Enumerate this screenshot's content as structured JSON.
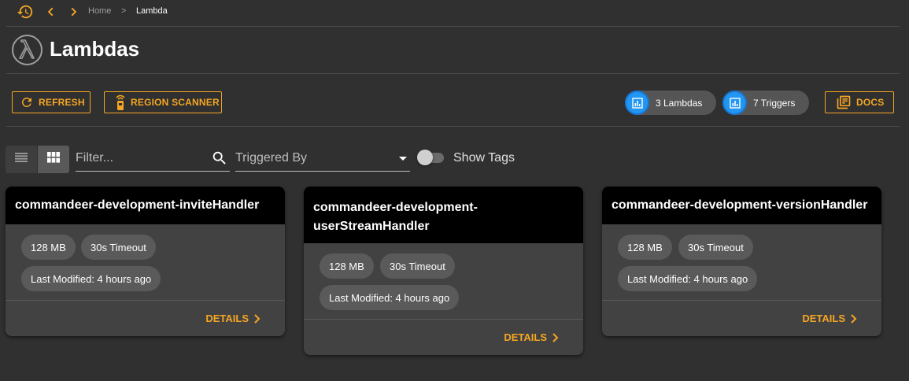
{
  "nav": {
    "breadcrumb": [
      "Home",
      ">",
      "Lambda"
    ]
  },
  "header": {
    "title": "Lambdas"
  },
  "toolbar": {
    "refresh_label": "REFRESH",
    "region_scanner_label": "REGION SCANNER",
    "lambdas_count_label": "3 Lambdas",
    "triggers_count_label": "7 Triggers",
    "docs_label": "DOCS"
  },
  "filters": {
    "filter_placeholder": "Filter...",
    "triggered_by_value": "Triggered By",
    "show_tags_label": "Show Tags",
    "show_tags_on": false
  },
  "cards": [
    {
      "title": "commandeer-development-inviteHandler",
      "memory": "128 MB",
      "timeout": "30s Timeout",
      "last_modified": "Last Modified: 4 hours ago",
      "details_label": "DETAILS"
    },
    {
      "title": "commandeer-development-userStreamHandler",
      "title_line1": "commandeer-development-",
      "title_line2": "userStreamHandler",
      "memory": "128 MB",
      "timeout": "30s Timeout",
      "last_modified": "Last Modified: 4 hours ago",
      "details_label": "DETAILS"
    },
    {
      "title": "commandeer-development-versionHandler",
      "memory": "128 MB",
      "timeout": "30s Timeout",
      "last_modified": "Last Modified: 4 hours ago",
      "details_label": "DETAILS"
    }
  ],
  "colors": {
    "accent": "#f5a623",
    "background": "#303030",
    "card": "#424242",
    "card_header": "#000000",
    "stat_avatar": "#2196f3"
  },
  "icons": {
    "history": "history-icon",
    "back": "chevron-left-icon",
    "forward": "chevron-right-icon",
    "logo": "lambda-icon",
    "refresh": "refresh-icon",
    "scanner": "scanner-icon",
    "stats": "bar-chart-icon",
    "docs": "docs-icon",
    "list_view": "list-view-icon",
    "grid_view": "grid-view-icon",
    "search": "search-icon"
  }
}
